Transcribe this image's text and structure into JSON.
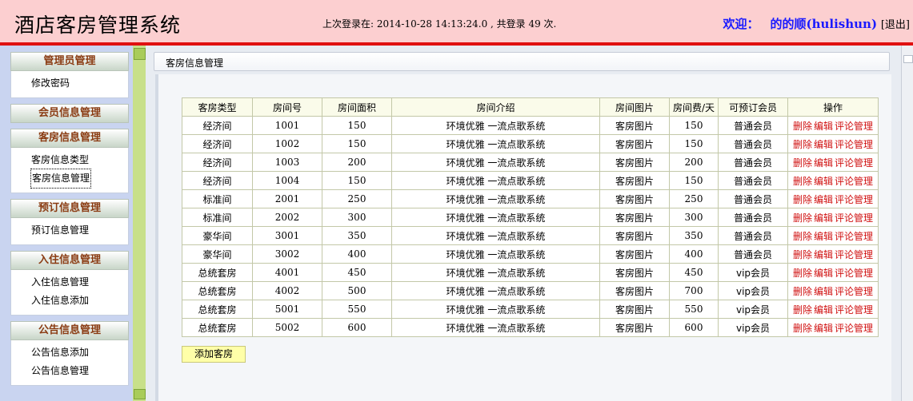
{
  "header": {
    "title": "酒店客房管理系统",
    "last_login": "上次登录在: 2014-10-28 14:13:24.0 , 共登录  49 次.",
    "welcome_label": "欢迎：",
    "user_name": "的的顺(hulishun)",
    "logout": "[退出]"
  },
  "sidebar": {
    "sections": [
      {
        "title": "管理员管理",
        "links": [
          "修改密码"
        ]
      },
      {
        "title": "会员信息管理",
        "links": []
      },
      {
        "title": "客房信息管理",
        "links": [
          "客房信息类型",
          "客房信息管理"
        ]
      },
      {
        "title": "预订信息管理",
        "links": [
          "预订信息管理"
        ]
      },
      {
        "title": "入住信息管理",
        "links": [
          "入住信息管理",
          "入住信息添加"
        ]
      },
      {
        "title": "公告信息管理",
        "links": [
          "公告信息添加",
          "公告信息管理"
        ]
      }
    ]
  },
  "main": {
    "breadcrumb": "客房信息管理",
    "table": {
      "columns": [
        "客房类型",
        "房间号",
        "房间面积",
        "房间介绍",
        "房间图片",
        "房间费/天",
        "可预订会员",
        "操作"
      ],
      "rows": [
        [
          "经济间",
          "1001",
          "150",
          "环境优雅 一流点歌系统",
          "客房图片",
          "150",
          "普通会员"
        ],
        [
          "经济间",
          "1002",
          "150",
          "环境优雅 一流点歌系统",
          "客房图片",
          "150",
          "普通会员"
        ],
        [
          "经济间",
          "1003",
          "200",
          "环境优雅 一流点歌系统",
          "客房图片",
          "200",
          "普通会员"
        ],
        [
          "经济间",
          "1004",
          "150",
          "环境优雅 一流点歌系统",
          "客房图片",
          "150",
          "普通会员"
        ],
        [
          "标准间",
          "2001",
          "250",
          "环境优雅 一流点歌系统",
          "客房图片",
          "250",
          "普通会员"
        ],
        [
          "标准间",
          "2002",
          "300",
          "环境优雅 一流点歌系统",
          "客房图片",
          "300",
          "普通会员"
        ],
        [
          "豪华间",
          "3001",
          "350",
          "环境优雅 一流点歌系统",
          "客房图片",
          "350",
          "普通会员"
        ],
        [
          "豪华间",
          "3002",
          "400",
          "环境优雅 一流点歌系统",
          "客房图片",
          "400",
          "普通会员"
        ],
        [
          "总统套房",
          "4001",
          "450",
          "环境优雅 一流点歌系统",
          "客房图片",
          "450",
          "vip会员"
        ],
        [
          "总统套房",
          "4002",
          "500",
          "环境优雅 一流点歌系统",
          "客房图片",
          "700",
          "vip会员"
        ],
        [
          "总统套房",
          "5001",
          "550",
          "环境优雅 一流点歌系统",
          "客房图片",
          "550",
          "vip会员"
        ],
        [
          "总统套房",
          "5002",
          "600",
          "环境优雅 一流点歌系统",
          "客房图片",
          "600",
          "vip会员"
        ]
      ],
      "actions": [
        "删除",
        "编辑",
        "评论管理"
      ]
    },
    "add_button": "添加客房"
  },
  "colors": {
    "header_bg": "#fccfd0",
    "header_line": "#e01010",
    "welcome_blue": "#1a1aff",
    "sidebar_bg": "#c9d4f0",
    "section_title": "#8a3b12",
    "action_red": "#d01010",
    "splitter_green": "#c8e08a"
  }
}
